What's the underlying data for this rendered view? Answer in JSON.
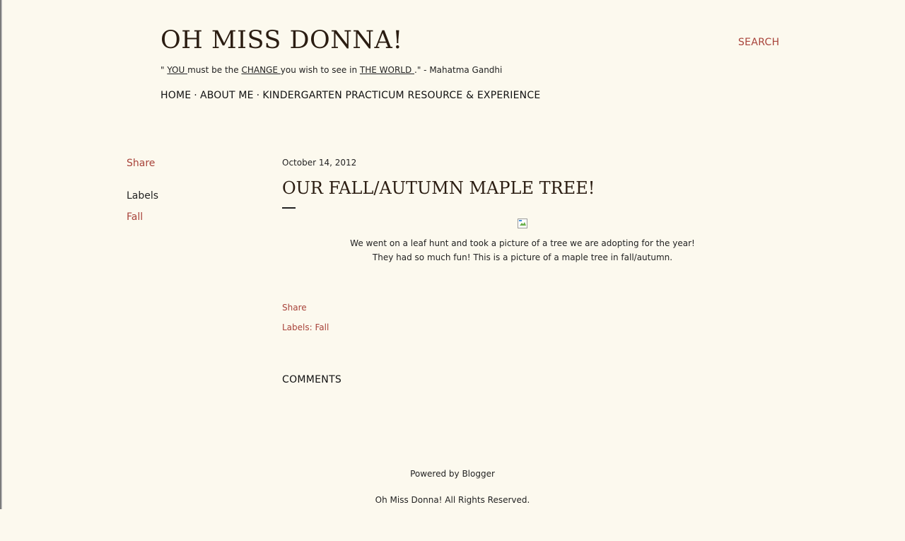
{
  "header": {
    "title": "OH MISS DONNA!",
    "search_label": "SEARCH",
    "tagline": {
      "q1": "\" ",
      "you": "YOU ",
      "t1": "must be the ",
      "change": "CHANGE ",
      "t2": "you wish to see in ",
      "world": "THE WORLD ",
      "t3": ".\" - Mahatma Gandhi"
    }
  },
  "nav": {
    "items": [
      "HOME",
      "ABOUT ME",
      "KINDERGARTEN PRACTICUM RESOURCE & EXPERIENCE"
    ],
    "separator": "·"
  },
  "sidebar": {
    "share_label": "Share",
    "labels_heading": "Labels",
    "labels": [
      "Fall"
    ]
  },
  "post": {
    "date": "October 14, 2012",
    "title": "OUR FALL/AUTUMN MAPLE TREE!",
    "body_line1": "We went on a leaf hunt and took a picture of a tree we are adopting for the year!",
    "body_line2": "They had so much fun! This is a picture of a maple tree in fall/autumn.",
    "share_label": "Share",
    "labels_prefix": "Labels: ",
    "labels": [
      "Fall"
    ]
  },
  "comments": {
    "heading": "COMMENTS"
  },
  "footer": {
    "powered": "Powered by Blogger",
    "rights": "Oh Miss Donna! All Rights Reserved."
  },
  "colors": {
    "background": "#fcf9ee",
    "link": "#a8433a",
    "title": "#2b1d12"
  },
  "icons": {
    "post_image": "broken-image-icon"
  }
}
